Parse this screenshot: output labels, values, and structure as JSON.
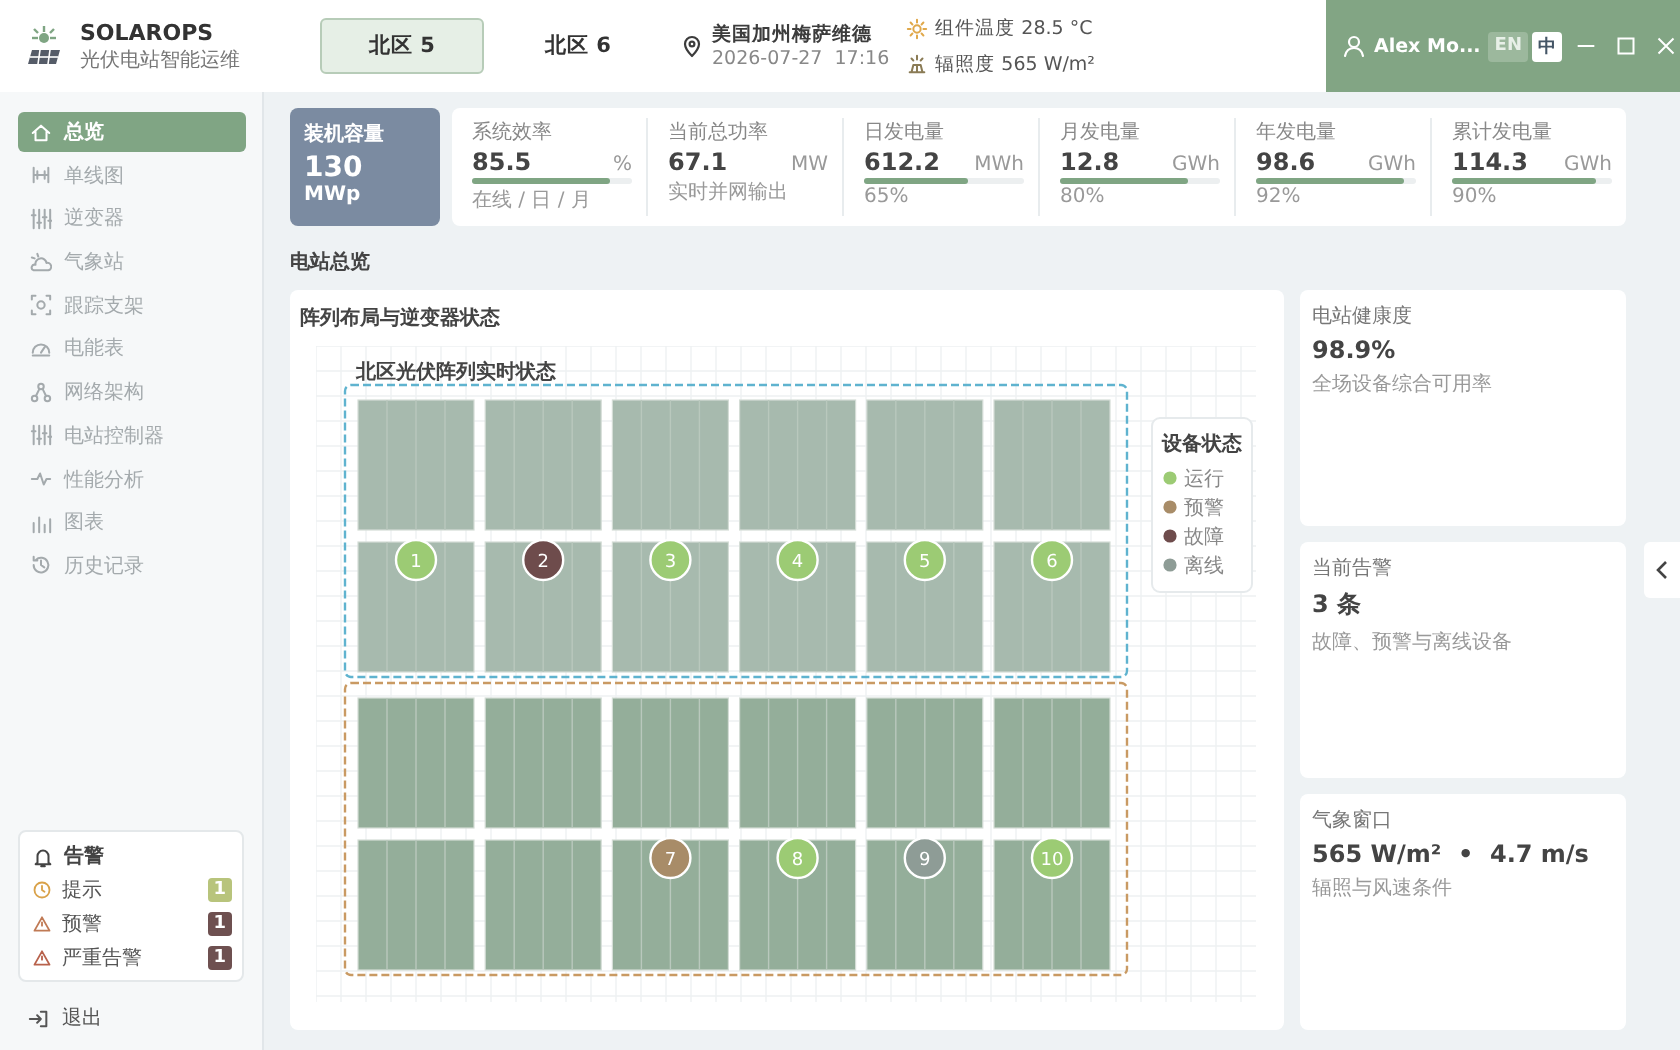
{
  "app": {
    "title": "SOLAROPS",
    "subtitle": "光伏电站智能运维"
  },
  "site_tabs": [
    {
      "label": "北区 5",
      "selected": true
    },
    {
      "label": "北区 6",
      "selected": false
    }
  ],
  "location": {
    "name": "美国加州梅萨维德",
    "datetime": "2026-07-27  17:16"
  },
  "weather": [
    {
      "kind": "temperature",
      "text": "组件温度 28.5 °C"
    },
    {
      "kind": "irradiance",
      "text": "辐照度 565 W/m²"
    }
  ],
  "user": {
    "name": "Alex Mo..."
  },
  "languages": [
    {
      "label": "EN",
      "selected": false
    },
    {
      "label": "中",
      "selected": true
    }
  ],
  "sidebar": {
    "items": [
      {
        "label": "总览",
        "selected": true
      },
      {
        "label": "单线图",
        "selected": false
      },
      {
        "label": "逆变器",
        "selected": false
      },
      {
        "label": "气象站",
        "selected": false
      },
      {
        "label": "跟踪支架",
        "selected": false
      },
      {
        "label": "电能表",
        "selected": false
      },
      {
        "label": "网络架构",
        "selected": false
      },
      {
        "label": "电站控制器",
        "selected": false
      },
      {
        "label": "性能分析",
        "selected": false
      },
      {
        "label": "图表",
        "selected": false
      },
      {
        "label": "历史记录",
        "selected": false
      }
    ],
    "alerts": {
      "title": "告警",
      "items": [
        {
          "kind": "info",
          "label": "提示",
          "count": "1",
          "color": "#b8c47c"
        },
        {
          "kind": "warning",
          "label": "预警",
          "count": "1",
          "color": "#6e5050"
        },
        {
          "kind": "critical",
          "label": "严重告警",
          "count": "1",
          "color": "#6e5050"
        }
      ]
    },
    "logout": "退出"
  },
  "capacity": {
    "label": "装机容量",
    "value": "130",
    "unit": "MWp"
  },
  "metrics": [
    {
      "label": "系统效率",
      "value": "85.5",
      "unit": "%",
      "level": 0.86,
      "sub": "在线 / 日 / 月"
    },
    {
      "label": "当前总功率",
      "value": "67.1",
      "unit": "MW",
      "sub": "实时并网输出"
    },
    {
      "label": "日发电量",
      "value": "612.2",
      "unit": "MWh",
      "level": 0.65,
      "sub": "65%"
    },
    {
      "label": "月发电量",
      "value": "12.8",
      "unit": "GWh",
      "level": 0.8,
      "sub": "80%"
    },
    {
      "label": "年发电量",
      "value": "98.6",
      "unit": "GWh",
      "level": 0.92,
      "sub": "92%"
    },
    {
      "label": "累计发电量",
      "value": "114.3",
      "unit": "GWh",
      "level": 0.9,
      "sub": "90%"
    }
  ],
  "section_title": "电站总览",
  "array_card": {
    "title": "阵列布局与逆变器状态",
    "diagram_title": "北区光伏阵列实时状态",
    "groups": [
      {
        "color": "#5fb3cf",
        "inverters": [
          {
            "label": "1",
            "kind": "running"
          },
          {
            "label": "2",
            "kind": "fault"
          },
          {
            "label": "3",
            "kind": "running"
          },
          {
            "label": "4",
            "kind": "running"
          },
          {
            "label": "5",
            "kind": "running"
          },
          {
            "label": "6",
            "kind": "running"
          }
        ]
      },
      {
        "color": "#c99a63",
        "inverters": [
          {
            "label": "7",
            "kind": "warning"
          },
          {
            "label": "8",
            "kind": "running"
          },
          {
            "label": "9",
            "kind": "offline"
          },
          {
            "label": "10",
            "kind": "running"
          }
        ]
      }
    ],
    "legend": {
      "title": "设备状态",
      "items": [
        {
          "kind": "running",
          "label": "运行",
          "color": "#9ccb74"
        },
        {
          "kind": "warning",
          "label": "预警",
          "color": "#a88c68"
        },
        {
          "kind": "fault",
          "label": "故障",
          "color": "#6e4c4c"
        },
        {
          "kind": "offline",
          "label": "离线",
          "color": "#8e9c96"
        }
      ]
    }
  },
  "info_cards": [
    {
      "label": "电站健康度",
      "value": "98.9%",
      "sub": "全场设备综合可用率"
    },
    {
      "label": "当前告警",
      "value": "3 条",
      "sub": "故障、预警与离线设备"
    },
    {
      "label": "气象窗口",
      "value": "565 W/m²  •  4.7 m/s",
      "sub": "辐照与风速条件"
    }
  ]
}
